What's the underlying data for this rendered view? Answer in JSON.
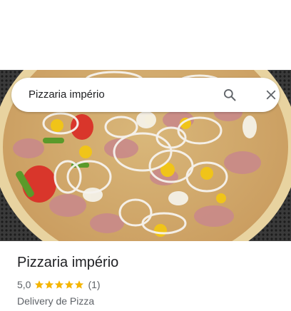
{
  "search": {
    "query": "Pizzaria império"
  },
  "place": {
    "name": "Pizzaria império",
    "rating": "5,0",
    "stars": 5,
    "review_count": "(1)",
    "category": "Delivery de Pizza"
  },
  "colors": {
    "star": "#f4b400",
    "text_primary": "#202124",
    "text_secondary": "#5f6368"
  },
  "icons": {
    "search": "search-icon",
    "close": "close-icon",
    "star": "star-icon"
  }
}
